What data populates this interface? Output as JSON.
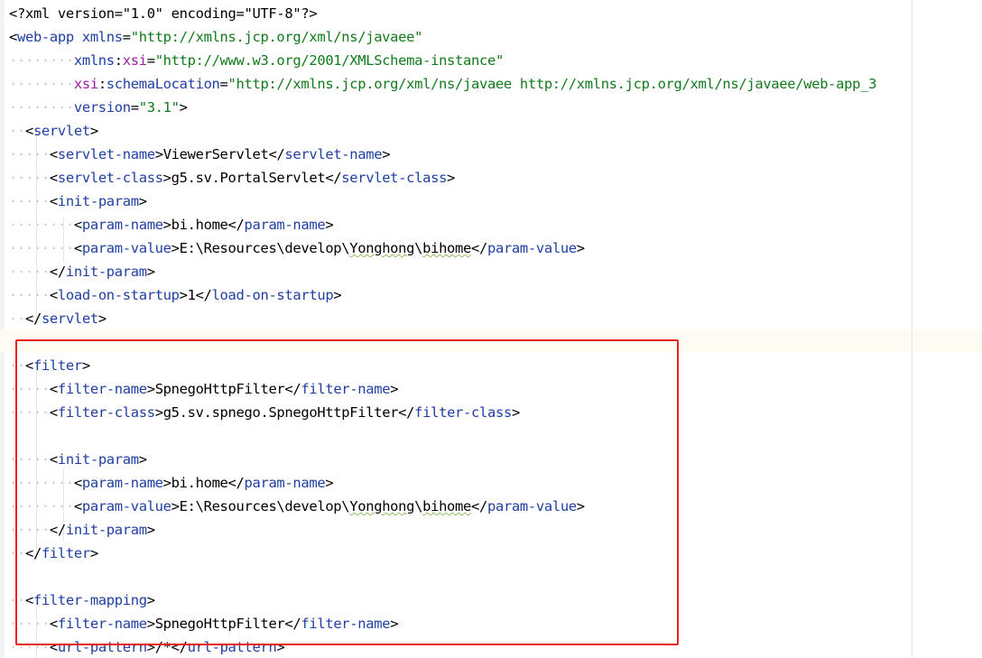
{
  "editor": {
    "lines": [
      [
        [
          "pi",
          "<?xml version=\"1.0\" encoding=\"UTF-8\"?>"
        ]
      ],
      [
        [
          "br",
          "<"
        ],
        [
          "tag",
          "web-app"
        ],
        [
          "txt",
          " "
        ],
        [
          "attr",
          "xmlns"
        ],
        [
          "br",
          "="
        ],
        [
          "val",
          "\"http://xmlns.jcp.org/xml/ns/javaee\""
        ]
      ],
      [
        [
          "ind",
          "········"
        ],
        [
          "attr",
          "xmlns"
        ],
        [
          "br",
          ":"
        ],
        [
          "ns",
          "xsi"
        ],
        [
          "br",
          "="
        ],
        [
          "val",
          "\"http://www.w3.org/2001/XMLSchema-instance\""
        ]
      ],
      [
        [
          "ind",
          "········"
        ],
        [
          "ns",
          "xsi"
        ],
        [
          "br",
          ":"
        ],
        [
          "attr",
          "schemaLocation"
        ],
        [
          "br",
          "="
        ],
        [
          "val",
          "\"http://xmlns.jcp.org/xml/ns/javaee http://xmlns.jcp.org/xml/ns/javaee/web-app_3"
        ]
      ],
      [
        [
          "ind",
          "········"
        ],
        [
          "attr",
          "version"
        ],
        [
          "br",
          "="
        ],
        [
          "val",
          "\"3.1\""
        ],
        [
          "br",
          ">"
        ]
      ],
      [
        [
          "ind",
          "··"
        ],
        [
          "br",
          "<"
        ],
        [
          "tag",
          "servlet"
        ],
        [
          "br",
          ">"
        ]
      ],
      [
        [
          "ind",
          "·····"
        ],
        [
          "br",
          "<"
        ],
        [
          "tag",
          "servlet-name"
        ],
        [
          "br",
          ">"
        ],
        [
          "txt",
          "ViewerServlet"
        ],
        [
          "br",
          "</"
        ],
        [
          "tag",
          "servlet-name"
        ],
        [
          "br",
          ">"
        ]
      ],
      [
        [
          "ind",
          "·····"
        ],
        [
          "br",
          "<"
        ],
        [
          "tag",
          "servlet-class"
        ],
        [
          "br",
          ">"
        ],
        [
          "txt",
          "g5.sv.PortalServlet"
        ],
        [
          "br",
          "</"
        ],
        [
          "tag",
          "servlet-class"
        ],
        [
          "br",
          ">"
        ]
      ],
      [
        [
          "ind",
          "·····"
        ],
        [
          "br",
          "<"
        ],
        [
          "tag",
          "init-param"
        ],
        [
          "br",
          ">"
        ]
      ],
      [
        [
          "ind",
          "········"
        ],
        [
          "br",
          "<"
        ],
        [
          "tag",
          "param-name"
        ],
        [
          "br",
          ">"
        ],
        [
          "txt",
          "bi.home"
        ],
        [
          "br",
          "</"
        ],
        [
          "tag",
          "param-name"
        ],
        [
          "br",
          ">"
        ]
      ],
      [
        [
          "ind",
          "········"
        ],
        [
          "br",
          "<"
        ],
        [
          "tag",
          "param-value"
        ],
        [
          "br",
          ">"
        ],
        [
          "txt",
          "E:\\Resources\\develop\\"
        ],
        [
          "typo",
          "Yonghong"
        ],
        [
          "txt",
          "\\"
        ],
        [
          "typo",
          "bihome"
        ],
        [
          "br",
          "</"
        ],
        [
          "tag",
          "param-value"
        ],
        [
          "br",
          ">"
        ]
      ],
      [
        [
          "ind",
          "·····"
        ],
        [
          "br",
          "</"
        ],
        [
          "tag",
          "init-param"
        ],
        [
          "br",
          ">"
        ]
      ],
      [
        [
          "ind",
          "·····"
        ],
        [
          "br",
          "<"
        ],
        [
          "tag",
          "load-on-startup"
        ],
        [
          "br",
          ">"
        ],
        [
          "txt",
          "1"
        ],
        [
          "br",
          "</"
        ],
        [
          "tag",
          "load-on-startup"
        ],
        [
          "br",
          ">"
        ]
      ],
      [
        [
          "ind",
          "··"
        ],
        [
          "br",
          "</"
        ],
        [
          "tag",
          "servlet"
        ],
        [
          "br",
          ">"
        ]
      ],
      [],
      [
        [
          "ind",
          "··"
        ],
        [
          "br",
          "<"
        ],
        [
          "tag",
          "filter"
        ],
        [
          "br",
          ">"
        ]
      ],
      [
        [
          "ind",
          "·····"
        ],
        [
          "br",
          "<"
        ],
        [
          "tag",
          "filter-name"
        ],
        [
          "br",
          ">"
        ],
        [
          "txt",
          "SpnegoHttpFilter"
        ],
        [
          "br",
          "</"
        ],
        [
          "tag",
          "filter-name"
        ],
        [
          "br",
          ">"
        ]
      ],
      [
        [
          "ind",
          "·····"
        ],
        [
          "br",
          "<"
        ],
        [
          "tag",
          "filter-class"
        ],
        [
          "br",
          ">"
        ],
        [
          "txt",
          "g5.sv.spnego.SpnegoHttpFilter"
        ],
        [
          "br",
          "</"
        ],
        [
          "tag",
          "filter-class"
        ],
        [
          "br",
          ">"
        ]
      ],
      [],
      [
        [
          "ind",
          "·····"
        ],
        [
          "br",
          "<"
        ],
        [
          "tag",
          "init-param"
        ],
        [
          "br",
          ">"
        ]
      ],
      [
        [
          "ind",
          "········"
        ],
        [
          "br",
          "<"
        ],
        [
          "tag",
          "param-name"
        ],
        [
          "br",
          ">"
        ],
        [
          "txt",
          "bi.home"
        ],
        [
          "br",
          "</"
        ],
        [
          "tag",
          "param-name"
        ],
        [
          "br",
          ">"
        ]
      ],
      [
        [
          "ind",
          "········"
        ],
        [
          "br",
          "<"
        ],
        [
          "tag",
          "param-value"
        ],
        [
          "br",
          ">"
        ],
        [
          "txt",
          "E:\\Resources\\develop\\"
        ],
        [
          "typo",
          "Yonghong"
        ],
        [
          "txt",
          "\\"
        ],
        [
          "typo",
          "bihome"
        ],
        [
          "br",
          "</"
        ],
        [
          "tag",
          "param-value"
        ],
        [
          "br",
          ">"
        ]
      ],
      [
        [
          "ind",
          "·····"
        ],
        [
          "br",
          "</"
        ],
        [
          "tag",
          "init-param"
        ],
        [
          "br",
          ">"
        ]
      ],
      [
        [
          "ind",
          "··"
        ],
        [
          "br",
          "</"
        ],
        [
          "tag",
          "filter"
        ],
        [
          "br",
          ">"
        ]
      ],
      [],
      [
        [
          "ind",
          "··"
        ],
        [
          "br",
          "<"
        ],
        [
          "tag",
          "filter-mapping"
        ],
        [
          "br",
          ">"
        ]
      ],
      [
        [
          "ind",
          "·····"
        ],
        [
          "br",
          "<"
        ],
        [
          "tag",
          "filter-name"
        ],
        [
          "br",
          ">"
        ],
        [
          "txt",
          "SpnegoHttpFilter"
        ],
        [
          "br",
          "</"
        ],
        [
          "tag",
          "filter-name"
        ],
        [
          "br",
          ">"
        ]
      ],
      [
        [
          "ind",
          "·····"
        ],
        [
          "br",
          "<"
        ],
        [
          "tag",
          "url-pattern"
        ],
        [
          "br",
          ">"
        ],
        [
          "txt",
          "/*"
        ],
        [
          "br",
          "</"
        ],
        [
          "tag",
          "url-pattern"
        ],
        [
          "br",
          ">"
        ]
      ]
    ]
  },
  "highlight_color": "#e8231f"
}
